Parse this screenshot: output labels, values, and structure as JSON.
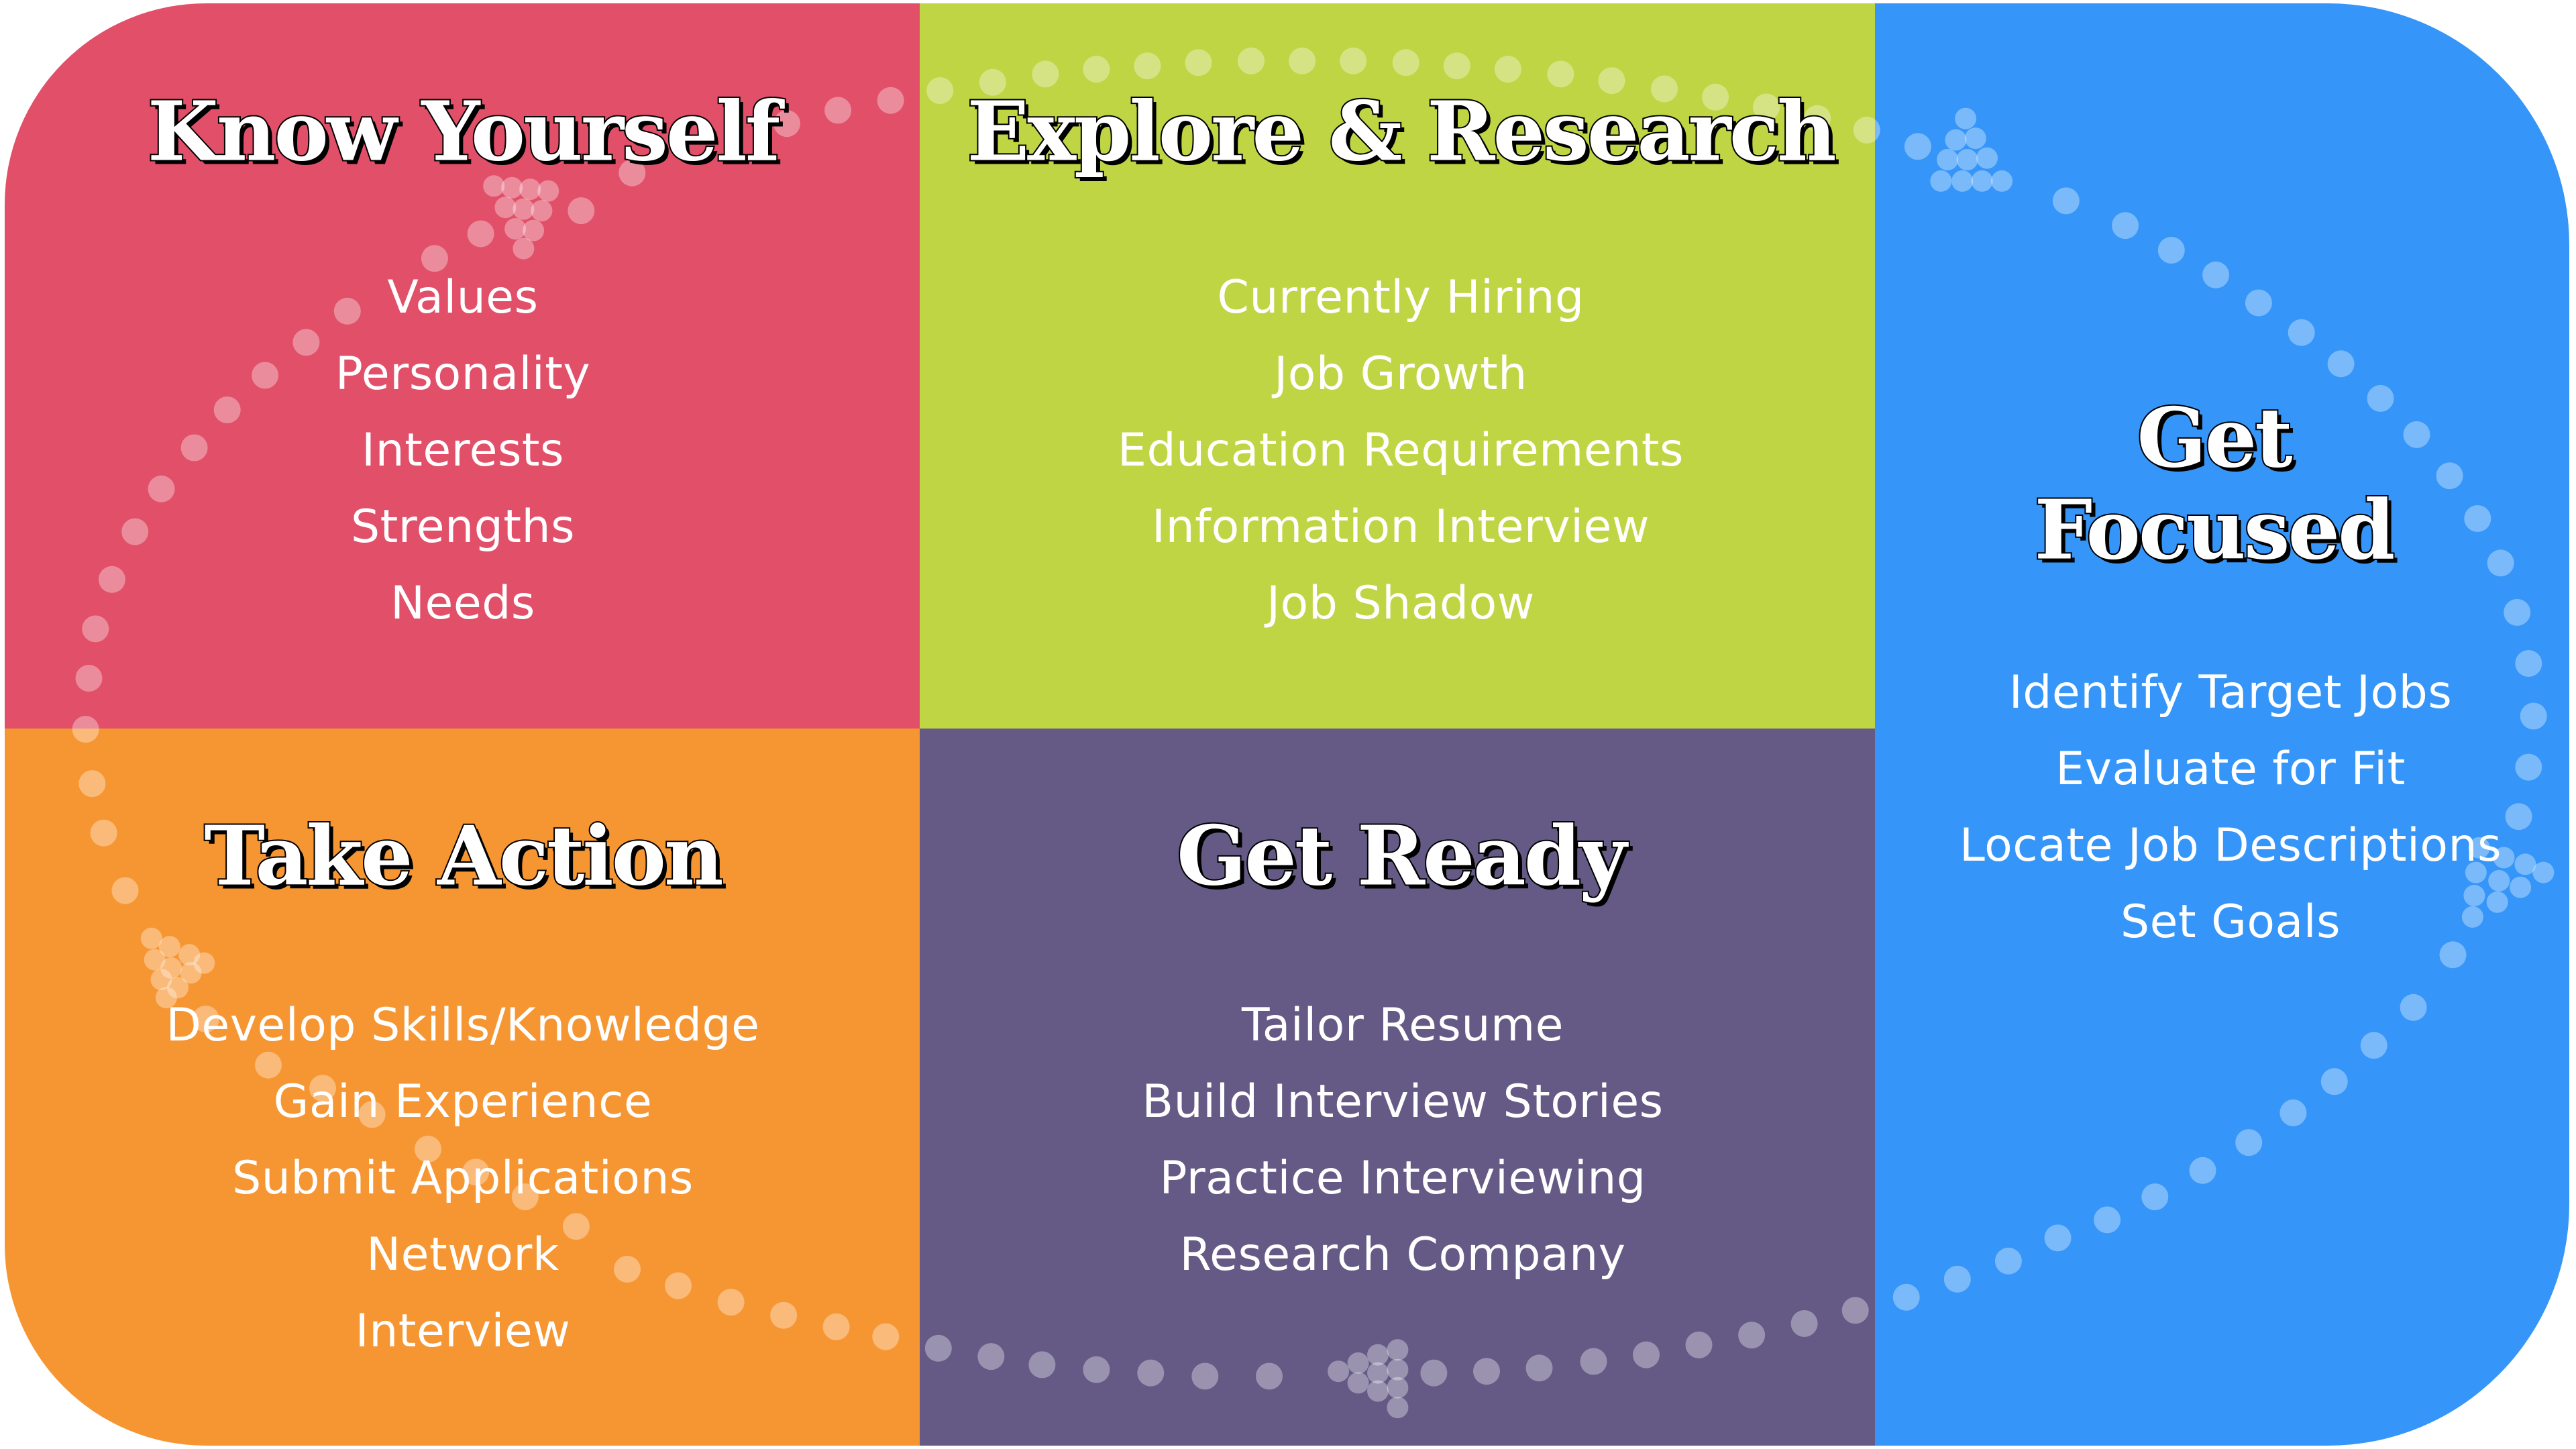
{
  "colors": {
    "know_yourself": "#E14F69",
    "explore_research": "#C0D544",
    "get_focused": "#3595F8",
    "take_action": "#F69633",
    "get_ready": "#645A85",
    "dot_fill": "#FFFFFF"
  },
  "sections": {
    "know_yourself": {
      "title": "Know Yourself",
      "items": [
        "Values",
        "Personality",
        "Interests",
        "Strengths",
        "Needs"
      ]
    },
    "explore_research": {
      "title": "Explore & Research",
      "items": [
        "Currently Hiring",
        "Job Growth",
        "Education Requirements",
        "Information Interview",
        "Job Shadow"
      ]
    },
    "get_focused": {
      "title_line1": "Get",
      "title_line2": "Focused",
      "items": [
        "Identify Target Jobs",
        "Evaluate for Fit",
        "Locate Job Descriptions",
        "Set Goals"
      ]
    },
    "take_action": {
      "title": "Take Action",
      "items": [
        "Develop Skills/Knowledge",
        "Gain Experience",
        "Submit Applications",
        "Network",
        "Interview"
      ]
    },
    "get_ready": {
      "title": "Get Ready",
      "items": [
        "Tailor Resume",
        "Build Interview Stories",
        "Practice Interviewing",
        "Research Company"
      ]
    }
  },
  "cycle_flow": [
    "Know Yourself",
    "Explore & Research",
    "Get Focused",
    "Get Ready",
    "Take Action"
  ]
}
